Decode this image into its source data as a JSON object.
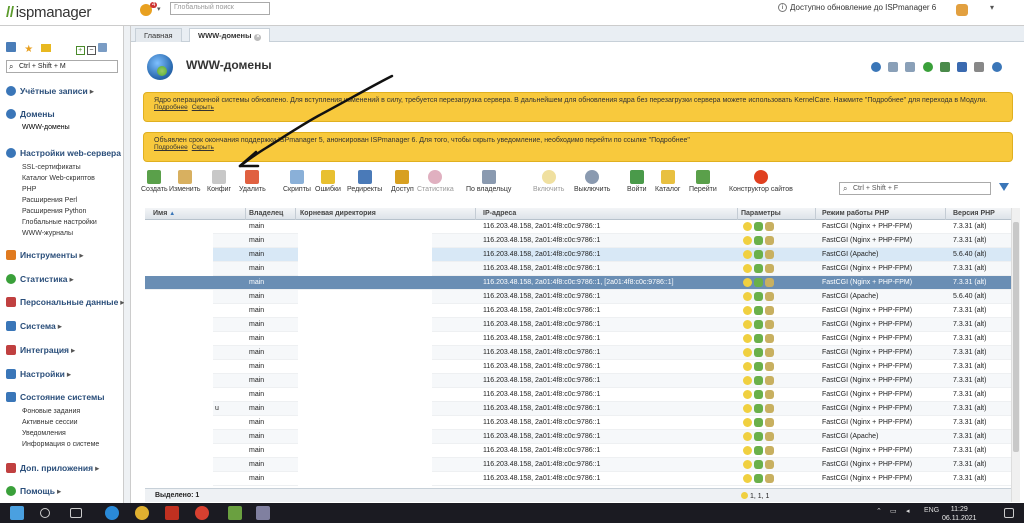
{
  "app": {
    "logo_prefix": "//",
    "logo_text": "ispmanager"
  },
  "topbar": {
    "global_search_placeholder": "Глобальный поиск",
    "update_text": "Доступно обновление до ISPmanager 6",
    "badge": "4"
  },
  "tabs": [
    {
      "label": "Главная"
    },
    {
      "label": "WWW-домены"
    }
  ],
  "sidebar": {
    "search_placeholder": "Ctrl + Shift + M",
    "sections": [
      {
        "label": "Учётные записи",
        "color": "#3a76b8"
      },
      {
        "label": "Домены",
        "color": "#3a76b8"
      },
      {
        "label": "Настройки web-сервера",
        "color": "#3a76b8"
      },
      {
        "label": "Инструменты",
        "color": "#e07a1f"
      },
      {
        "label": "Статистика",
        "color": "#3aa03a"
      },
      {
        "label": "Персональные данные",
        "color": "#c04040"
      },
      {
        "label": "Система",
        "color": "#3a76b8"
      },
      {
        "label": "Интеграция",
        "color": "#c04040"
      },
      {
        "label": "Настройки",
        "color": "#3a76b8"
      },
      {
        "label": "Состояние системы",
        "color": "#3a76b8"
      },
      {
        "label": "Доп. приложения",
        "color": "#c04040"
      },
      {
        "label": "Помощь",
        "color": "#3aa03a"
      }
    ],
    "domains_sub": [
      "WWW-домены"
    ],
    "web_sub": [
      "SSL-сертификаты",
      "Каталог Web-скриптов",
      "PHP",
      "Расширения Perl",
      "Расширения Python",
      "Глобальные настройки",
      "WWW-журналы"
    ],
    "state_sub": [
      "Фоновые задания",
      "Активные сессии",
      "Уведомления",
      "Информация о системе"
    ]
  },
  "page": {
    "title": "WWW-домены"
  },
  "notices": [
    {
      "text": "Ядро операционной системы обновлено. Для вступления изменений в силу, требуется перезагрузка сервера. В дальнейшем для обновления ядра без перезагрузки сервера можете использовать KernelCare. Нажмите \"Подробнее\" для перехода в Модули.",
      "link1": "Подробнее",
      "link2": "Скрыть"
    },
    {
      "text": "Объявлен срок окончания поддержки ISPmanager 5, анонсирован ISPmanager 6. Для того, чтобы скрыть уведомление, необходимо перейти по ссылке \"Подробнее\"",
      "link1": "Подробнее",
      "link2": "Скрыть"
    }
  ],
  "toolbar": {
    "buttons": [
      "Создать",
      "Изменить",
      "Конфиг",
      "Удалить",
      "Скрипты",
      "Ошибки",
      "Редиректы",
      "Доступ",
      "Статистика",
      "По владельцу",
      "Включить",
      "Выключить",
      "Войти",
      "Каталог",
      "Перейти",
      "Конструктор сайтов"
    ],
    "filter_placeholder": "Ctrl + Shift + F"
  },
  "grid": {
    "columns": [
      "Имя",
      "Владелец",
      "Корневая директория",
      "IP-адреса",
      "Параметры",
      "Режим работы PHP",
      "Версия PHP"
    ],
    "sort_mark": "▲",
    "rows": [
      {
        "owner": "main",
        "ip": "116.203.48.158, 2a01:4f8:c0c:9786::1",
        "php_mode": "FastCGI (Nginx + PHP-FPM)",
        "php_ver": "7.3.31 (alt)"
      },
      {
        "owner": "main",
        "ip": "116.203.48.158, 2a01:4f8:c0c:9786::1",
        "php_mode": "FastCGI (Nginx + PHP-FPM)",
        "php_ver": "7.3.31 (alt)"
      },
      {
        "owner": "main",
        "ip": "116.203.48.158, 2a01:4f8:c0c:9786::1",
        "php_mode": "FastCGI (Apache)",
        "php_ver": "5.6.40 (alt)"
      },
      {
        "owner": "main",
        "ip": "116.203.48.158, 2a01:4f8:c0c:9786::1",
        "php_mode": "FastCGI (Nginx + PHP-FPM)",
        "php_ver": "7.3.31 (alt)"
      },
      {
        "owner": "main",
        "ip": "116.203.48.158, 2a01:4f8:c0c:9786::1, [2a01:4f8:c0c:9786::1]",
        "php_mode": "FastCGI (Nginx + PHP-FPM)",
        "php_ver": "7.3.31 (alt)"
      },
      {
        "owner": "main",
        "ip": "116.203.48.158, 2a01:4f8:c0c:9786::1",
        "php_mode": "FastCGI (Apache)",
        "php_ver": "5.6.40 (alt)"
      },
      {
        "owner": "main",
        "ip": "116.203.48.158, 2a01:4f8:c0c:9786::1",
        "php_mode": "FastCGI (Nginx + PHP-FPM)",
        "php_ver": "7.3.31 (alt)"
      },
      {
        "owner": "main",
        "ip": "116.203.48.158, 2a01:4f8:c0c:9786::1",
        "php_mode": "FastCGI (Nginx + PHP-FPM)",
        "php_ver": "7.3.31 (alt)"
      },
      {
        "owner": "main",
        "ip": "116.203.48.158, 2a01:4f8:c0c:9786::1",
        "php_mode": "FastCGI (Nginx + PHP-FPM)",
        "php_ver": "7.3.31 (alt)"
      },
      {
        "owner": "main",
        "ip": "116.203.48.158, 2a01:4f8:c0c:9786::1",
        "php_mode": "FastCGI (Nginx + PHP-FPM)",
        "php_ver": "7.3.31 (alt)"
      },
      {
        "owner": "main",
        "ip": "116.203.48.158, 2a01:4f8:c0c:9786::1",
        "php_mode": "FastCGI (Nginx + PHP-FPM)",
        "php_ver": "7.3.31 (alt)"
      },
      {
        "owner": "main",
        "ip": "116.203.48.158, 2a01:4f8:c0c:9786::1",
        "php_mode": "FastCGI (Nginx + PHP-FPM)",
        "php_ver": "7.3.31 (alt)"
      },
      {
        "owner": "main",
        "ip": "116.203.48.158, 2a01:4f8:c0c:9786::1",
        "php_mode": "FastCGI (Nginx + PHP-FPM)",
        "php_ver": "7.3.31 (alt)"
      },
      {
        "owner": "main",
        "ip": "116.203.48.158, 2a01:4f8:c0c:9786::1",
        "php_mode": "FastCGI (Nginx + PHP-FPM)",
        "php_ver": "7.3.31 (alt)"
      },
      {
        "owner": "main",
        "ip": "116.203.48.158, 2a01:4f8:c0c:9786::1",
        "php_mode": "FastCGI (Nginx + PHP-FPM)",
        "php_ver": "7.3.31 (alt)"
      },
      {
        "owner": "main",
        "ip": "116.203.48.158, 2a01:4f8:c0c:9786::1",
        "php_mode": "FastCGI (Apache)",
        "php_ver": "7.3.31 (alt)"
      },
      {
        "owner": "main",
        "ip": "116.203.48.158, 2a01:4f8:c0c:9786::1",
        "php_mode": "FastCGI (Nginx + PHP-FPM)",
        "php_ver": "7.3.31 (alt)"
      },
      {
        "owner": "main",
        "ip": "116.203.48.158, 2a01:4f8:c0c:9786::1",
        "php_mode": "FastCGI (Nginx + PHP-FPM)",
        "php_ver": "7.3.31 (alt)"
      },
      {
        "owner": "main",
        "ip": "116.203.48.158, 2a01:4f8:c0c:9786::1",
        "php_mode": "FastCGI (Nginx + PHP-FPM)",
        "php_ver": "7.3.31 (alt)"
      }
    ],
    "name_fragment_row": 13,
    "name_fragment": "u"
  },
  "footer": {
    "selected_label": "Выделено: 1",
    "counts": "1, 1, 1"
  },
  "taskbar": {
    "lang": "ENG",
    "time": "11:29",
    "date": "06.11.2021"
  }
}
